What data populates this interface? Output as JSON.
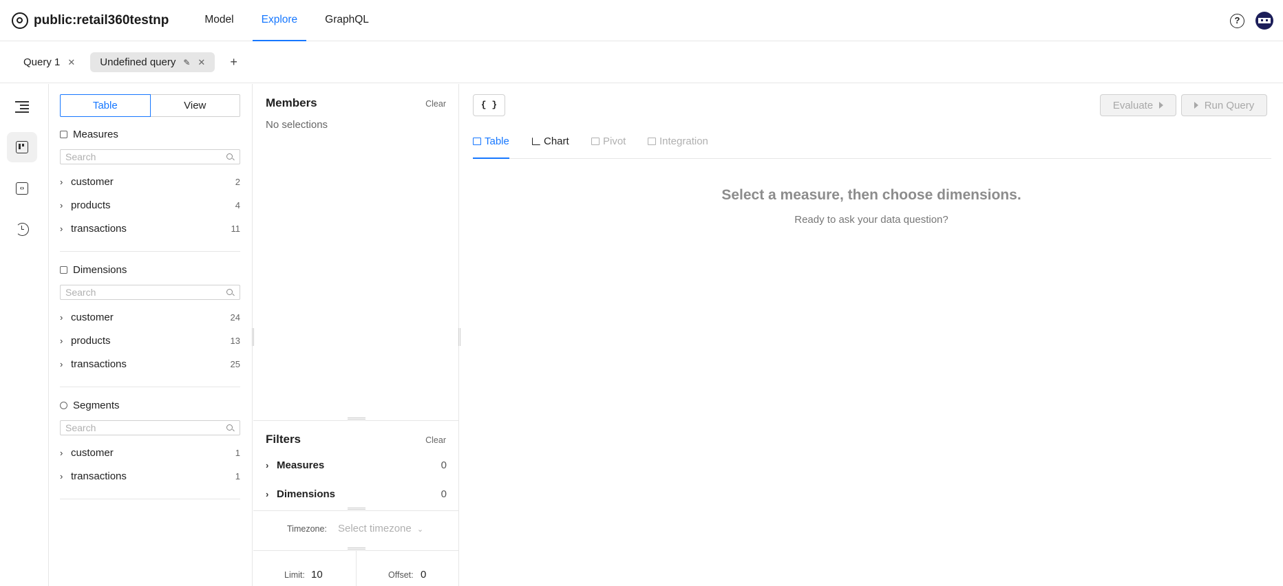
{
  "header": {
    "project": "public:retail360testnp",
    "nav": [
      "Model",
      "Explore",
      "GraphQL"
    ],
    "active_nav": "Explore",
    "help_glyph": "?"
  },
  "query_tabs": {
    "tabs": [
      {
        "label": "Query 1",
        "active": false
      },
      {
        "label": "Undefined query",
        "active": true
      }
    ],
    "add_glyph": "+"
  },
  "rail": {
    "icons": [
      "collapse-sidebar-icon",
      "schema-icon",
      "code-icon",
      "history-icon"
    ]
  },
  "schema": {
    "toggle": [
      "Table",
      "View"
    ],
    "search_placeholder": "Search",
    "measures": {
      "title": "Measures",
      "items": [
        {
          "label": "customer",
          "count": "2"
        },
        {
          "label": "products",
          "count": "4"
        },
        {
          "label": "transactions",
          "count": "11"
        }
      ]
    },
    "dimensions": {
      "title": "Dimensions",
      "items": [
        {
          "label": "customer",
          "count": "24"
        },
        {
          "label": "products",
          "count": "13"
        },
        {
          "label": "transactions",
          "count": "25"
        }
      ]
    },
    "segments": {
      "title": "Segments",
      "items": [
        {
          "label": "customer",
          "count": "1"
        },
        {
          "label": "transactions",
          "count": "1"
        }
      ]
    }
  },
  "members": {
    "title": "Members",
    "clear": "Clear",
    "empty": "No selections"
  },
  "filters": {
    "title": "Filters",
    "clear": "Clear",
    "rows": [
      {
        "label": "Measures",
        "count": "0"
      },
      {
        "label": "Dimensions",
        "count": "0"
      }
    ]
  },
  "settings": {
    "timezone_label": "Timezone:",
    "timezone_placeholder": "Select timezone",
    "limit_label": "Limit:",
    "limit_value": "10",
    "offset_label": "Offset:",
    "offset_value": "0"
  },
  "results": {
    "json_button": "{ }",
    "evaluate": "Evaluate",
    "run_query": "Run Query",
    "tabs": [
      {
        "label": "Table",
        "state": "active"
      },
      {
        "label": "Chart",
        "state": "enabled"
      },
      {
        "label": "Pivot",
        "state": "disabled"
      },
      {
        "label": "Integration",
        "state": "disabled"
      }
    ],
    "empty_title": "Select a measure, then choose dimensions.",
    "empty_subtitle": "Ready to ask your data question?"
  },
  "colors": {
    "accent": "#1677ff",
    "border": "#e6e6e6",
    "muted_text": "#8c8c8c"
  }
}
